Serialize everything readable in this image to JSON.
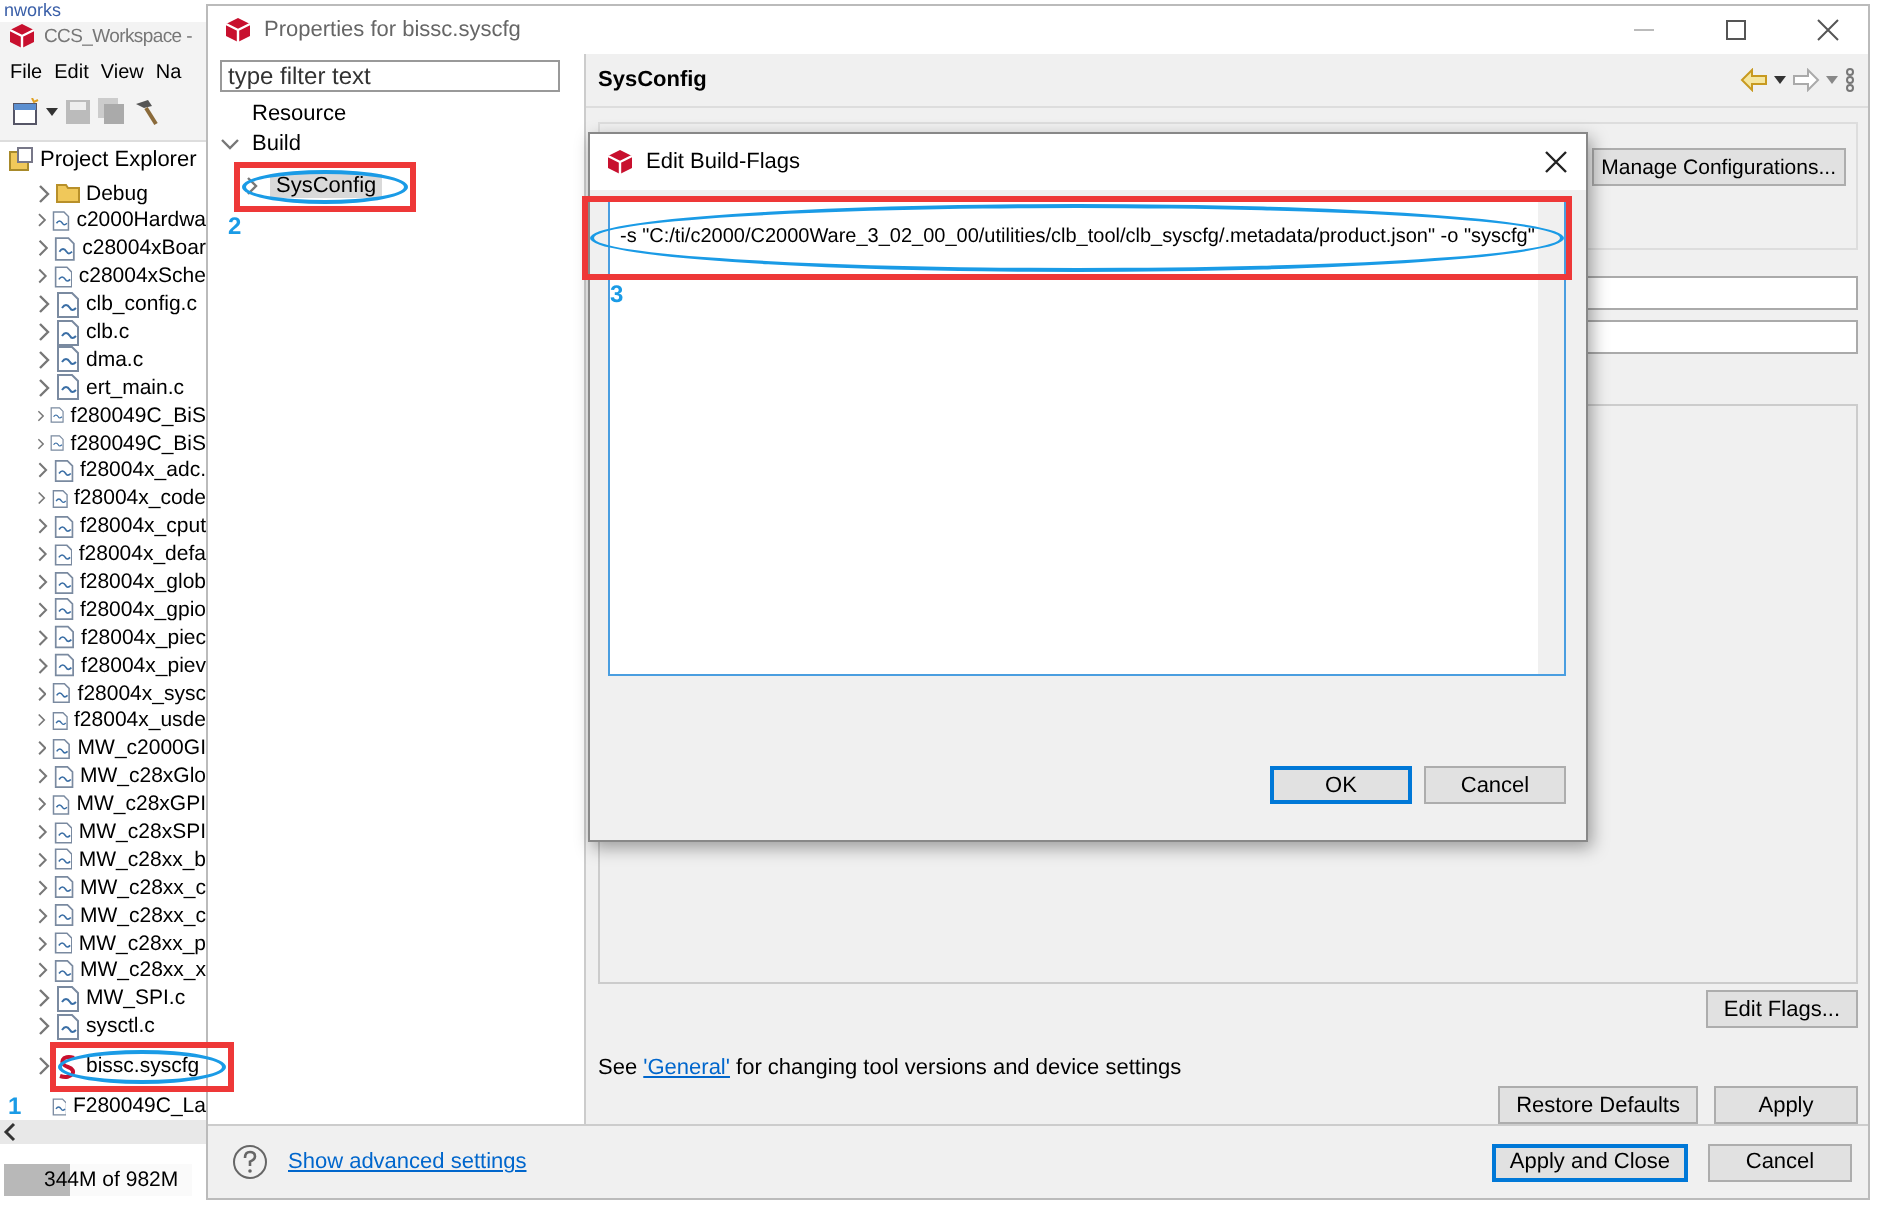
{
  "background_text": "nworks",
  "main_window": {
    "title": "CCS_Workspace -",
    "menu": [
      "File",
      "Edit",
      "View",
      "Na"
    ],
    "explorer": {
      "title": "Project Explorer",
      "items": [
        {
          "label": "Debug",
          "kind": "folder"
        },
        {
          "label": "c2000Hardwa",
          "kind": "file"
        },
        {
          "label": "c28004xBoar",
          "kind": "file"
        },
        {
          "label": "c28004xSche",
          "kind": "file"
        },
        {
          "label": "clb_config.c",
          "kind": "file"
        },
        {
          "label": "clb.c",
          "kind": "file"
        },
        {
          "label": "dma.c",
          "kind": "file"
        },
        {
          "label": "ert_main.c",
          "kind": "file"
        },
        {
          "label": "f280049C_BiS",
          "kind": "file"
        },
        {
          "label": "f280049C_BiS",
          "kind": "file"
        },
        {
          "label": "f28004x_adc.",
          "kind": "file"
        },
        {
          "label": "f28004x_code",
          "kind": "file"
        },
        {
          "label": "f28004x_cput",
          "kind": "file"
        },
        {
          "label": "f28004x_defa",
          "kind": "file"
        },
        {
          "label": "f28004x_glob",
          "kind": "file"
        },
        {
          "label": "f28004x_gpio",
          "kind": "file"
        },
        {
          "label": "f28004x_piec",
          "kind": "file"
        },
        {
          "label": "f28004x_piev",
          "kind": "file"
        },
        {
          "label": "f28004x_sysc",
          "kind": "file"
        },
        {
          "label": "f28004x_usde",
          "kind": "file"
        },
        {
          "label": "MW_c2000GI",
          "kind": "file"
        },
        {
          "label": "MW_c28xGlo",
          "kind": "file"
        },
        {
          "label": "MW_c28xGPI",
          "kind": "file"
        },
        {
          "label": "MW_c28xSPI",
          "kind": "file"
        },
        {
          "label": "MW_c28xx_b",
          "kind": "file"
        },
        {
          "label": "MW_c28xx_c",
          "kind": "file"
        },
        {
          "label": "MW_c28xx_c",
          "kind": "file"
        },
        {
          "label": "MW_c28xx_p",
          "kind": "file"
        },
        {
          "label": "MW_c28xx_x",
          "kind": "file"
        },
        {
          "label": "MW_SPI.c",
          "kind": "file"
        },
        {
          "label": "sysctl.c",
          "kind": "file"
        },
        {
          "label": "bissc.syscfg",
          "kind": "syscfg"
        },
        {
          "label": "F280049C_La",
          "kind": "file"
        }
      ]
    },
    "status": {
      "text": "344M of 982M",
      "level": 0.35
    }
  },
  "properties": {
    "title": "Properties for bissc.syscfg",
    "filter": {
      "placeholder": "type filter text"
    },
    "tree": [
      {
        "label": "Resource",
        "kind": "leaf",
        "selected": false
      },
      {
        "label": "Build",
        "kind": "node",
        "expanded": true,
        "selected": false,
        "children": [
          {
            "label": "SysConfig",
            "kind": "node",
            "expanded": false,
            "selected": true
          }
        ]
      }
    ],
    "page": {
      "heading": "SysConfig",
      "manage_button": "Manage Configurations...",
      "edit_flags_button": "Edit Flags...",
      "note": {
        "before": "See ",
        "link": "'General'",
        "after": " for changing tool versions and device settings"
      },
      "buttons": [
        "Restore Defaults",
        "Apply"
      ]
    },
    "footer": {
      "help_link": "Show advanced settings",
      "buttons": [
        {
          "label": "Apply and Close",
          "default": true
        },
        {
          "label": "Cancel",
          "default": false
        }
      ]
    }
  },
  "dialog": {
    "title": "Edit Build-Flags",
    "value": "-s \"C:/ti/c2000/C2000Ware_3_02_00_00/utilities/clb_tool/clb_syscfg/.metadata/product.json\" -o \"syscfg\"",
    "buttons": [
      {
        "label": "OK",
        "default": true
      },
      {
        "label": "Cancel",
        "default": false
      }
    ]
  },
  "annotations": {
    "numbers": [
      "1",
      "2",
      "3"
    ]
  }
}
